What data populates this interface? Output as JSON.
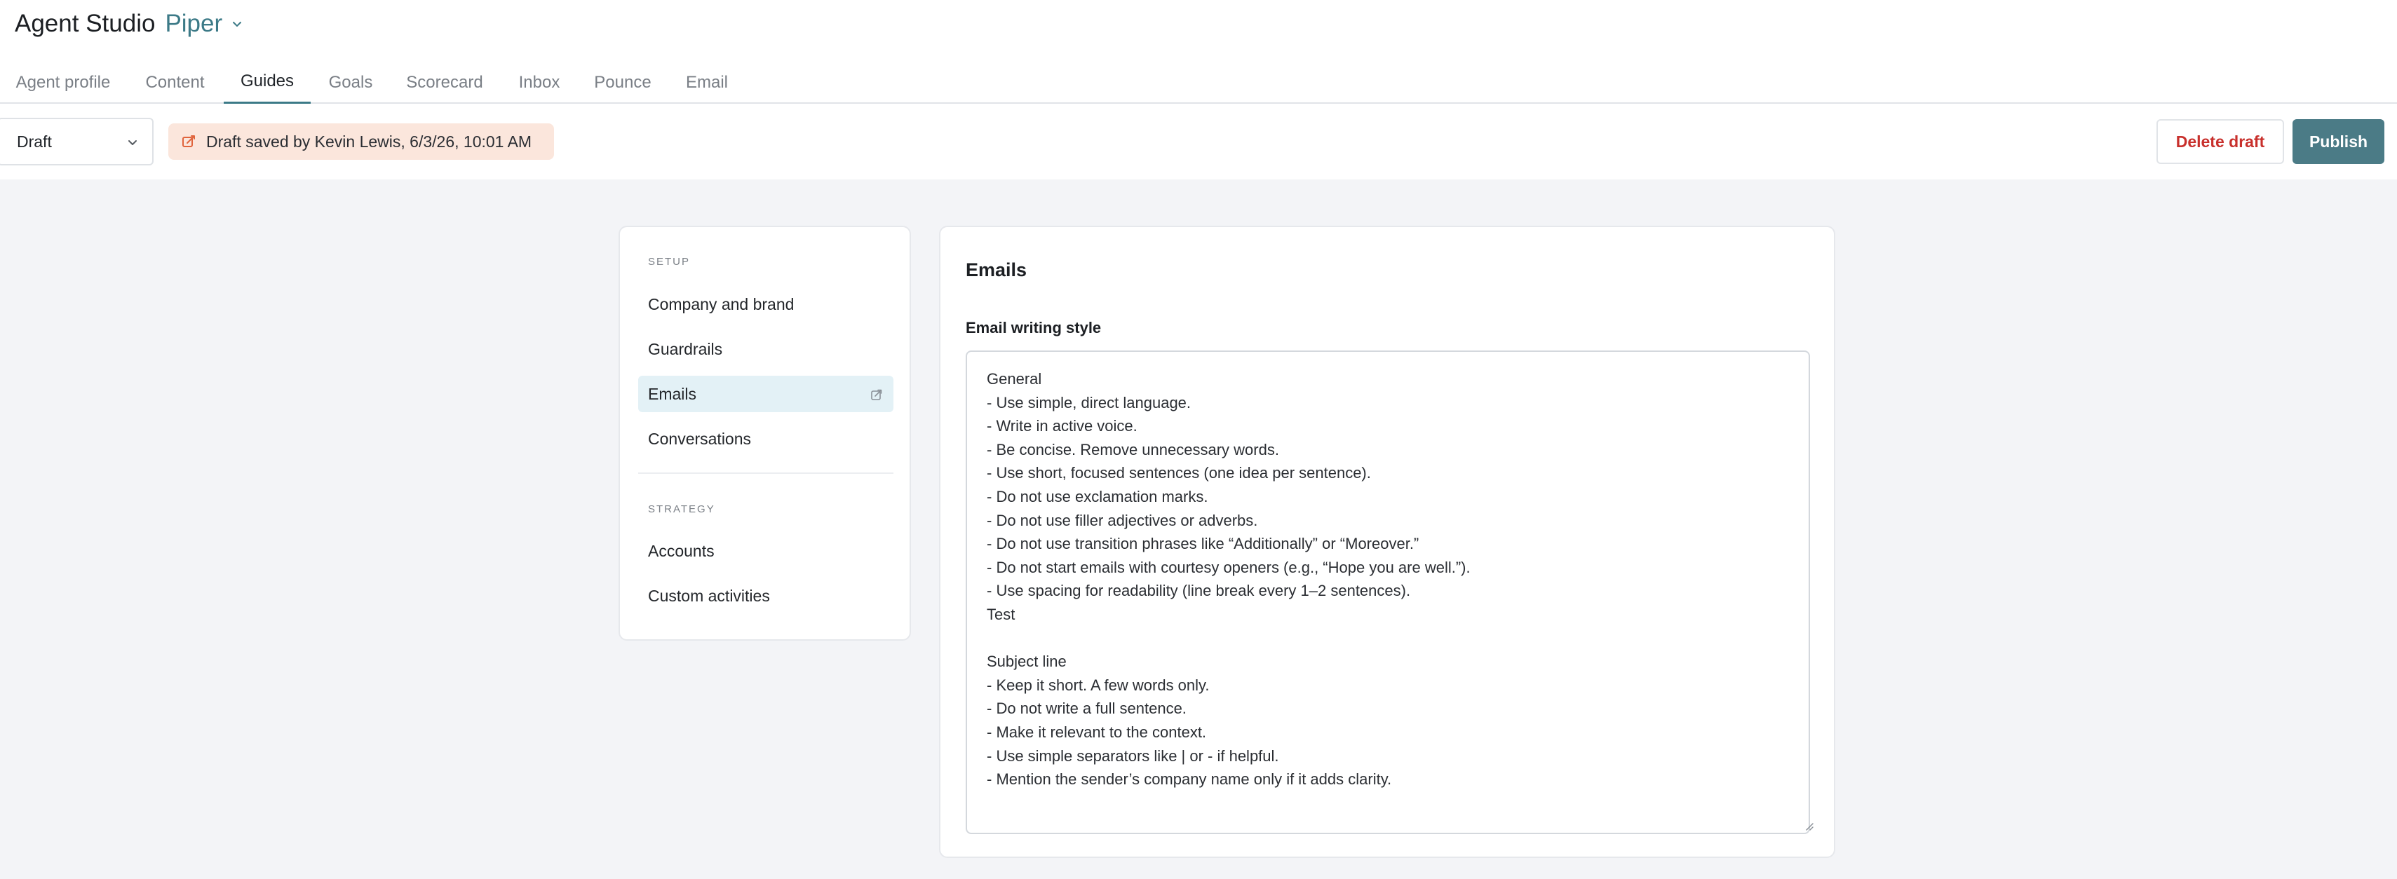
{
  "header": {
    "app_title": "Agent Studio",
    "agent_name": "Piper",
    "accent_color": "#3c7a87"
  },
  "tabs": [
    {
      "label": "Agent profile",
      "active": false
    },
    {
      "label": "Content",
      "active": false
    },
    {
      "label": "Guides",
      "active": true
    },
    {
      "label": "Goals",
      "active": false
    },
    {
      "label": "Scorecard",
      "active": false
    },
    {
      "label": "Inbox",
      "active": false
    },
    {
      "label": "Pounce",
      "active": false
    },
    {
      "label": "Email",
      "active": false
    }
  ],
  "toolbar": {
    "version_selected": "Draft",
    "draft_banner": "Draft saved by Kevin Lewis, 6/3/26, 10:01 AM",
    "delete_label": "Delete draft",
    "publish_label": "Publish",
    "delete_color": "#c8302c",
    "publish_color": "#4b7b86"
  },
  "nav": {
    "setup_heading": "SETUP",
    "setup_items": [
      {
        "label": "Company and brand",
        "active": false
      },
      {
        "label": "Guardrails",
        "active": false
      },
      {
        "label": "Emails",
        "active": true
      },
      {
        "label": "Conversations",
        "active": false
      }
    ],
    "strategy_heading": "STRATEGY",
    "strategy_items": [
      {
        "label": "Accounts",
        "active": false
      },
      {
        "label": "Custom activities",
        "active": false
      }
    ]
  },
  "main": {
    "title": "Emails",
    "field_label": "Email writing style",
    "textarea_value": "General\n- Use simple, direct language.\n- Write in active voice.\n- Be concise. Remove unnecessary words.\n- Use short, focused sentences (one idea per sentence).\n- Do not use exclamation marks.\n- Do not use filler adjectives or adverbs.\n- Do not use transition phrases like “Additionally” or “Moreover.”\n- Do not start emails with courtesy openers (e.g., “Hope you are well.”).\n- Use spacing for readability (line break every 1–2 sentences).\nTest\n\nSubject line\n- Keep it short. A few words only.\n- Do not write a full sentence.\n- Make it relevant to the context.\n- Use simple separators like | or - if helpful.\n- Mention the sender’s company name only if it adds clarity."
  }
}
